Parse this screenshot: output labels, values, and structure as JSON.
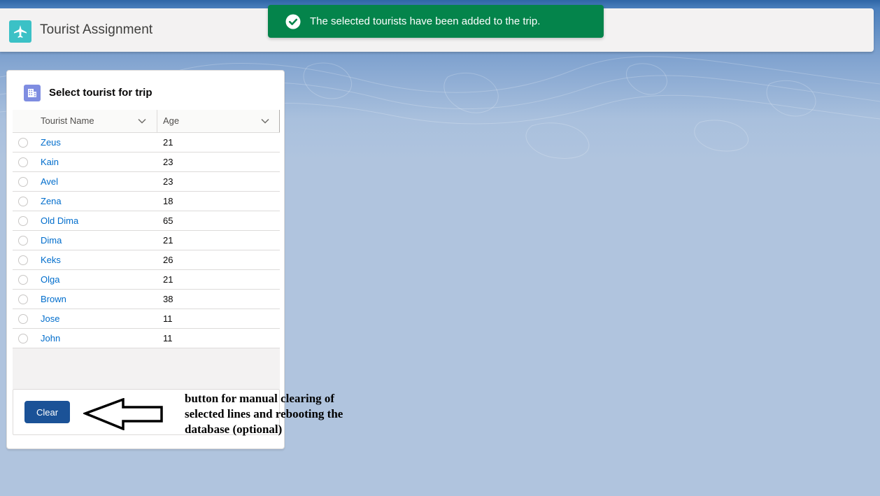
{
  "header": {
    "app_title": "Tourist Assignment",
    "app_icon": "airplane-icon",
    "app_icon_color": "#3bc1c6"
  },
  "toast": {
    "message": "The selected tourists have been added to the trip.",
    "icon": "check-circle-icon",
    "color": "#04844b"
  },
  "card": {
    "title": "Select tourist for trip",
    "icon": "building-icon",
    "icon_color": "#7f8de1",
    "columns": [
      "Tourist Name",
      "Age"
    ],
    "rows": [
      {
        "name": "Zeus",
        "age": "21"
      },
      {
        "name": "Kain",
        "age": "23"
      },
      {
        "name": "Avel",
        "age": "23"
      },
      {
        "name": "Zena",
        "age": "18"
      },
      {
        "name": "Old Dima",
        "age": "65"
      },
      {
        "name": "Dima",
        "age": "21"
      },
      {
        "name": "Keks",
        "age": "26"
      },
      {
        "name": "Olga",
        "age": "21"
      },
      {
        "name": "Brown",
        "age": "38"
      },
      {
        "name": "Jose",
        "age": "11"
      },
      {
        "name": "John",
        "age": "11"
      }
    ],
    "clear_button": "Clear",
    "clear_button_color": "#1b5297"
  },
  "annotation": {
    "text": "button for manual clearing of selected lines and rebooting the database (optional)"
  }
}
